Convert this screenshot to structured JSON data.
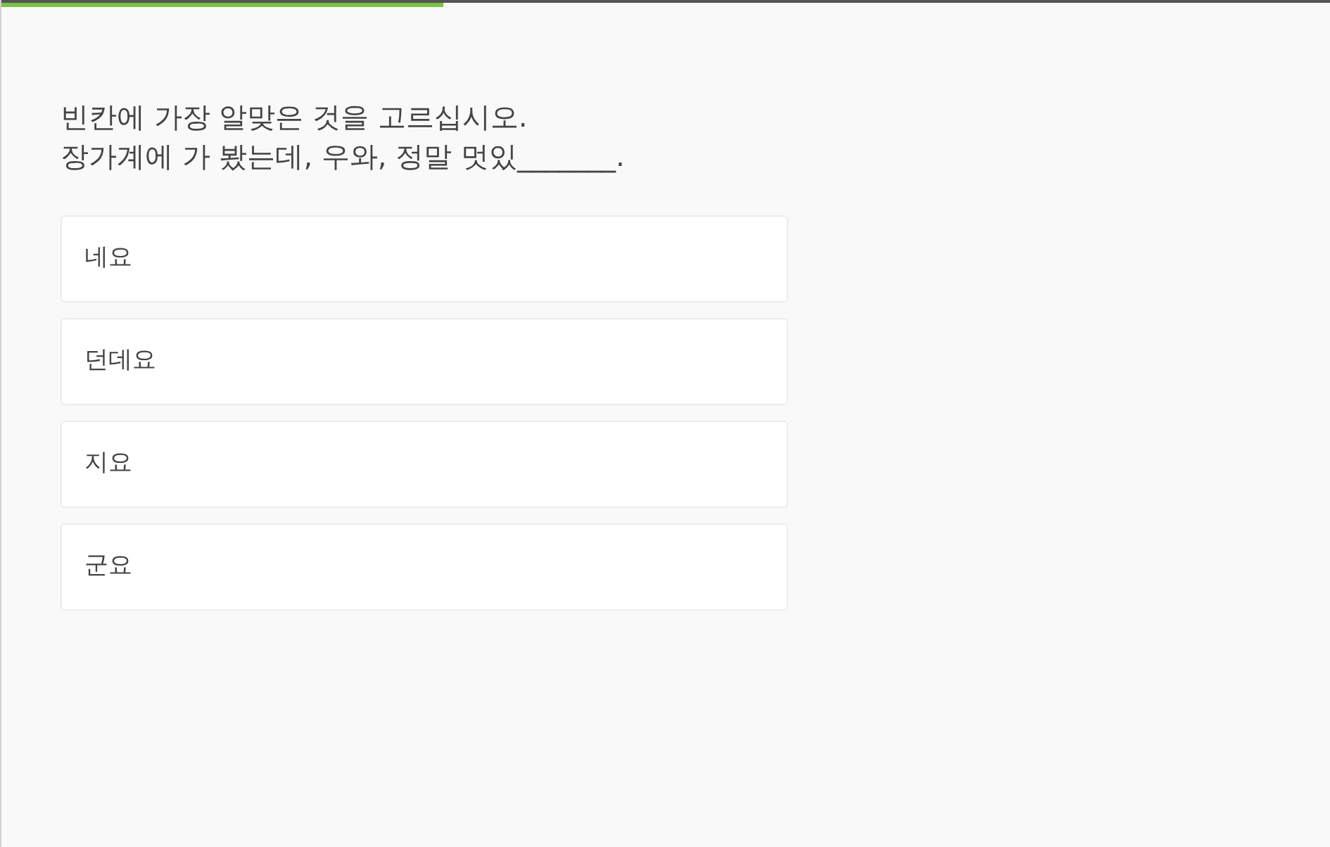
{
  "progress": {
    "level": 0.333
  },
  "question": {
    "instruction": "빈칸에 가장 알맞은 것을 고르십시오.",
    "sentence": "장가계에 가 봤는데, 우와, 정말 멋있_______."
  },
  "options": [
    {
      "label": "네요",
      "selected": false
    },
    {
      "label": "던데요",
      "selected": false
    },
    {
      "label": "지요",
      "selected": false
    },
    {
      "label": "군요",
      "selected": false
    }
  ]
}
